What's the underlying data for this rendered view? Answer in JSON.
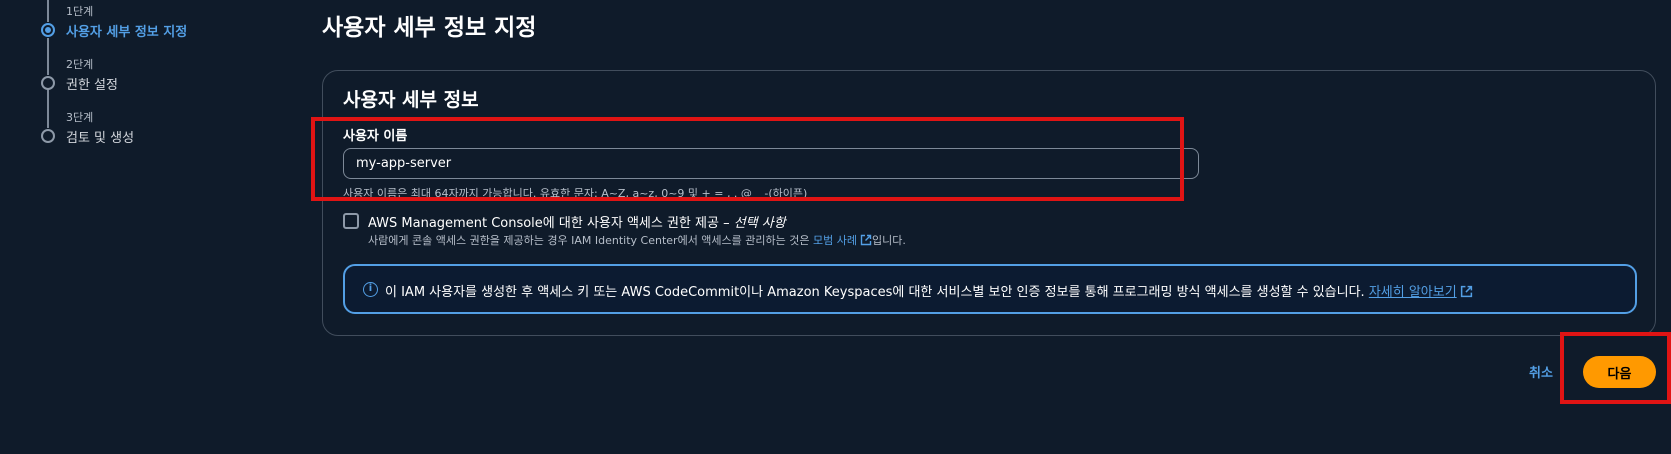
{
  "stepper": {
    "steps": [
      {
        "num": "1단계",
        "label": "사용자 세부 정보 지정",
        "active": true
      },
      {
        "num": "2단계",
        "label": "권한 설정",
        "active": false
      },
      {
        "num": "3단계",
        "label": "검토 및 생성",
        "active": false
      }
    ]
  },
  "page": {
    "title": "사용자 세부 정보 지정"
  },
  "user_details": {
    "panel_title": "사용자 세부 정보",
    "username_label": "사용자 이름",
    "username_value": "my-app-server",
    "username_hint": "사용자 이름은 최대 64자까지 가능합니다. 유효한 문자: A~Z, a~z, 0~9 및 + = , . @ _ -(하이픈)",
    "console_access": {
      "checked": false,
      "label": "AWS Management Console에 대한 사용자 액세스 권한 제공 – ",
      "optional": "선택 사항",
      "desc_prefix": "사람에게 콘솔 액세스 권한을 제공하는 경우 IAM Identity Center에서 액세스를 관리하는 것은 ",
      "desc_link": "모범 사례",
      "desc_suffix": "입니다."
    },
    "info": {
      "text": "이 IAM 사용자를 생성한 후 액세스 키 또는 AWS CodeCommit이나 Amazon Keyspaces에 대한 서비스별 보안 인증 정보를 통해 프로그래밍 방식 액세스를 생성할 수 있습니다. ",
      "link": "자세히 알아보기"
    }
  },
  "footer": {
    "cancel_label": "취소",
    "next_label": "다음"
  },
  "colors": {
    "background": "#0f1b2a",
    "accent_blue": "#539fe5",
    "primary_orange": "#ff9900",
    "highlight_red": "#e01414"
  }
}
